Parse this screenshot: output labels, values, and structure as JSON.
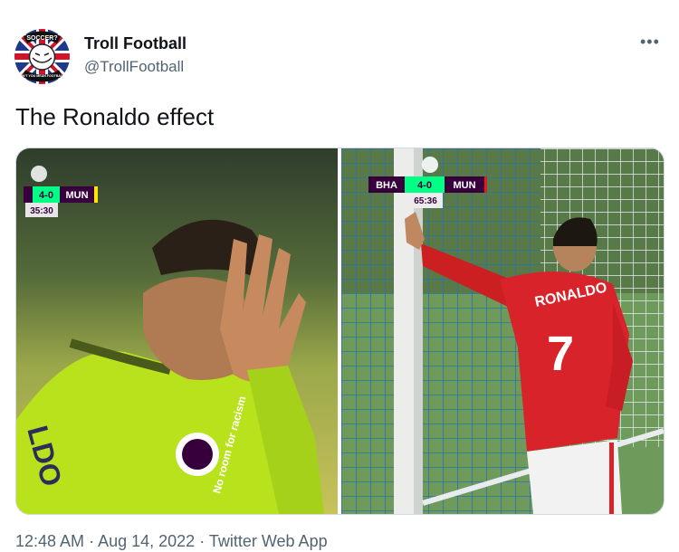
{
  "user": {
    "display_name": "Troll Football",
    "handle": "@TrollFootball",
    "avatar_badge_top": "SOCCER?",
    "avatar_badge_bottom": "DON'T YOU MEAN FOOTBALL?"
  },
  "tweet": {
    "text": "The Ronaldo effect",
    "more_label": "•••"
  },
  "left_photo": {
    "score": "4-0",
    "team": "MUN",
    "clock": "35:30",
    "shirt_text": "LDO",
    "sponsor": "No room for racism"
  },
  "right_photo": {
    "home": "BHA",
    "score": "4-0",
    "away": "MUN",
    "clock": "65:36",
    "shirt_name": "RONALDO",
    "shirt_number": "7"
  },
  "footer": {
    "time": "12:48 AM",
    "sep1": " · ",
    "date": "Aug 14, 2022",
    "sep2": " · ",
    "source": "Twitter Web App"
  },
  "colors": {
    "text": "#0f1419",
    "secondary": "#536471",
    "border": "#cfd9de",
    "pl_purple": "#37003c",
    "pl_green": "#00ff85"
  }
}
